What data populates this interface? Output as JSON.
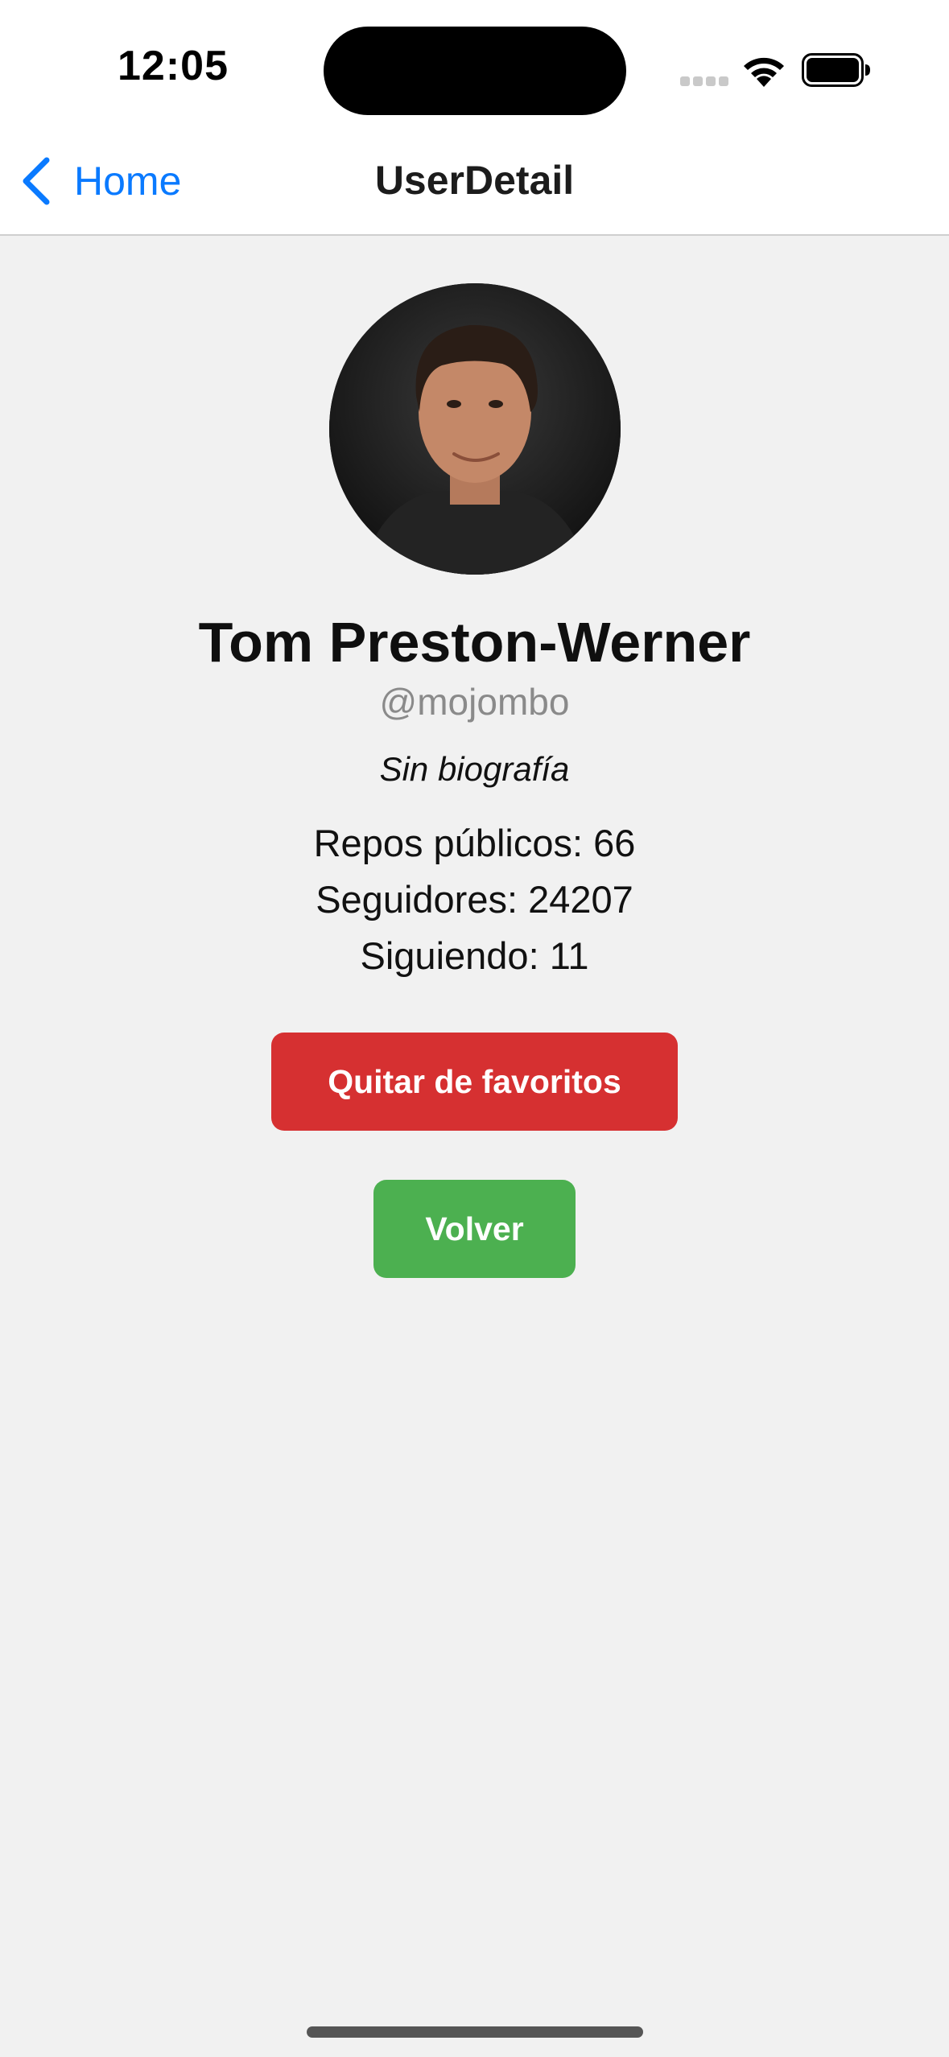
{
  "status_bar": {
    "time": "12:05",
    "icons": [
      "signal-icon",
      "wifi-icon",
      "battery-icon"
    ]
  },
  "nav_bar": {
    "back_label": "Home",
    "back_icon": "chevron-left-icon",
    "title": "UserDetail"
  },
  "user": {
    "name": "Tom Preston-Werner",
    "login": "@mojombo",
    "bio": "Sin biografía",
    "stats": [
      {
        "label": "Repos públicos: ",
        "value": "66"
      },
      {
        "label": "Seguidores: ",
        "value": "24207"
      },
      {
        "label": "Siguiendo: ",
        "value": "11"
      }
    ]
  },
  "actions": {
    "favorite_label": "Quitar de favoritos",
    "back_label": "Volver"
  },
  "colors": {
    "accent_blue": "#0a7aff",
    "favorite_red": "#d63031",
    "back_green": "#4cb050",
    "background": "#f1f1f1"
  }
}
